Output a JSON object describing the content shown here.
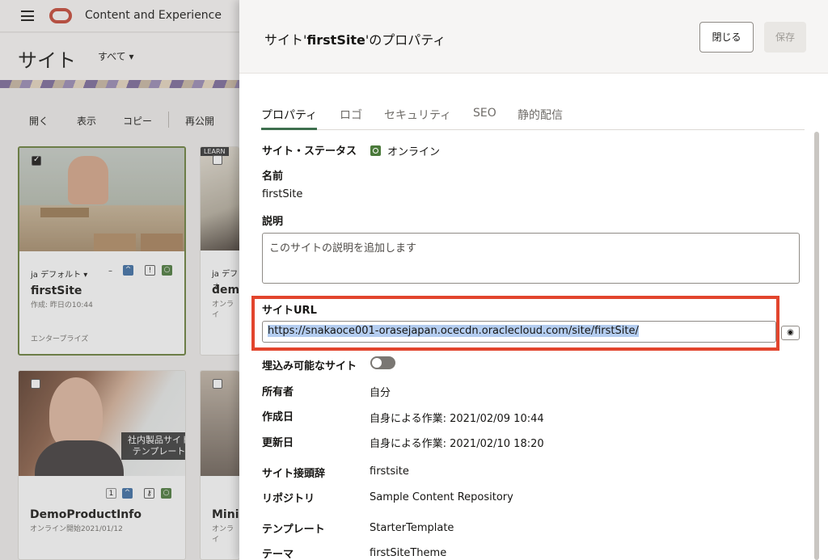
{
  "app": {
    "name": "Content and Experience",
    "page_title": "サイト",
    "filter_label": "すべて ▾"
  },
  "toolbar": {
    "open": "開く",
    "view": "表示",
    "copy": "コピー",
    "republish": "再公開"
  },
  "cards": [
    {
      "name": "firstSite",
      "meta": "作成: 昨日の10:44",
      "lang": "ja デフォルト ▾",
      "tag": "エンタープライズ"
    },
    {
      "name": "demo",
      "meta": "オンライ",
      "lang": "ja デフォ",
      "ribbon": "LEARN"
    },
    {
      "name": "DemoProductInfo",
      "meta": "オンライン開始2021/01/12",
      "overlay": "社内製品サイト\nテンプレート",
      "count": "1"
    },
    {
      "name": "Mini",
      "meta": "オンライ"
    }
  ],
  "panel": {
    "title_prefix": "サイト'",
    "title_site": "firstSite",
    "title_suffix": "'のプロパティ",
    "close_label": "閉じる",
    "save_label": "保存",
    "tabs": [
      "プロパティ",
      "ロゴ",
      "セキュリティ",
      "SEO",
      "静的配信"
    ],
    "status_label": "サイト・ステータス",
    "status_value": "オンライン",
    "name_label": "名前",
    "name_value": "firstSite",
    "desc_label": "説明",
    "desc_placeholder": "このサイトの説明を追加します",
    "url_label": "サイトURL",
    "url_value": "https://snakaoce001-orasejapan.ocecdn.oraclecloud.com/site/firstSite/",
    "embed_label": "埋込み可能なサイト",
    "owner_label": "所有者",
    "owner_value": "自分",
    "created_label": "作成日",
    "created_value": "自身による作業: 2021/02/09 10:44",
    "updated_label": "更新日",
    "updated_value": "自身による作業: 2021/02/10 18:20",
    "prefix_label": "サイト接頭辞",
    "prefix_value": "firstsite",
    "repo_label": "リポジトリ",
    "repo_value": "Sample Content Repository",
    "template_label": "テンプレート",
    "template_value": "StarterTemplate",
    "theme_label": "テーマ",
    "theme_value": "firstSiteTheme"
  },
  "colors": {
    "accent_green": "#3e6f4e",
    "highlight_red": "#e2452d",
    "brand_red": "#c74634"
  }
}
